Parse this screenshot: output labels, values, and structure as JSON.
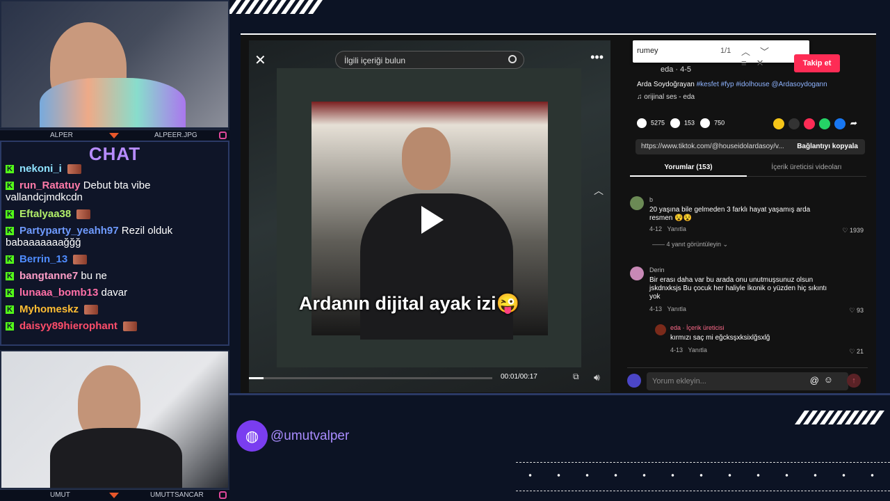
{
  "colors": {
    "accent": "#b78cff",
    "kick": "#53fc18",
    "tiktok": "#fe2c55"
  },
  "cams": {
    "top": {
      "left": "ALPER",
      "right": "ALPEER.JPG"
    },
    "bottom": {
      "left": "UMUT",
      "right": "UMUTTSANCAR"
    }
  },
  "chat": {
    "title": "CHAT",
    "messages": [
      {
        "user": "nekoni_i",
        "color": "#8fe3ff",
        "text": ""
      },
      {
        "user": "run_Ratatuy",
        "color": "#ff7aa8",
        "text": "Debut bta vibe vallandcjmdkcdn"
      },
      {
        "user": "Eftalyaa38",
        "color": "#b2f06a",
        "text": ""
      },
      {
        "user": "Partyparty_yeahh97",
        "color": "#6f9bff",
        "text": "Rezil olduk babaaaaaaağğğ"
      },
      {
        "user": "Berrin_13",
        "color": "#4f8cff",
        "text": ""
      },
      {
        "user": "bangtanne7",
        "color": "#ff9ec8",
        "text": "bu ne"
      },
      {
        "user": "lunaaa_bomb13",
        "color": "#ff6fa6",
        "text": "davar"
      },
      {
        "user": "Myhomeskz",
        "color": "#ffbd33",
        "text": ""
      },
      {
        "user": "daisyy89hierophant",
        "color": "#ff4d6a",
        "text": ""
      }
    ]
  },
  "video": {
    "search_placeholder": "İlgili içeriği bulun",
    "caption": "Ardanın dijital ayak izi😜",
    "time": "00:01/00:17",
    "progress": 0.06
  },
  "find": {
    "query": "rumey",
    "count": "1/1"
  },
  "post": {
    "follow_label": "Takip et",
    "author": "eda · 4-5",
    "description_prefix": "Arda Soydoğrayan ",
    "tags": "#kesfet #fyp #idolhouse @Ardasoydogann",
    "sound": "♫  orijinal ses - eda",
    "likes": "5275",
    "comments": "153",
    "saves": "750",
    "url": "https://www.tiktok.com/@houseidolardasoy/v...",
    "copy_label": "Bağlantıyı kopyala",
    "tab_comments": "Yorumlar (153)",
    "tab_creator": "İçerik üreticisi videoları"
  },
  "comments": [
    {
      "name": "b",
      "text": "20 yaşına bile gelmeden 3 farklı hayat yaşamış arda resmen 😵😵",
      "date": "4-12",
      "reply": "Yanıtla",
      "likes": "♡ 1939",
      "more": "—— 4 yanıt görüntüleyin ⌄"
    },
    {
      "name": "Derin",
      "text": "Bir erası daha var bu arada onu unutmuşsunuz olsun jskdnxksjs Bu çocuk her haliyle İkonik o yüzden hiç sıkıntı yok",
      "date": "4-13",
      "reply": "Yanıtla",
      "likes": "♡ 93"
    },
    {
      "name": "eda · İçerik üreticisi",
      "text": "kırmızı saç mi eğcksşxksixlğsxlğ",
      "date": "4-13",
      "reply": "Yanıtla",
      "likes": "♡ 21"
    }
  ],
  "comment_input": {
    "placeholder": "Yorum ekleyin...",
    "at": "@",
    "emoji": "☺",
    "send": "↑"
  },
  "social": {
    "handle": "@umutvalper",
    "icon": "globe-icon"
  }
}
